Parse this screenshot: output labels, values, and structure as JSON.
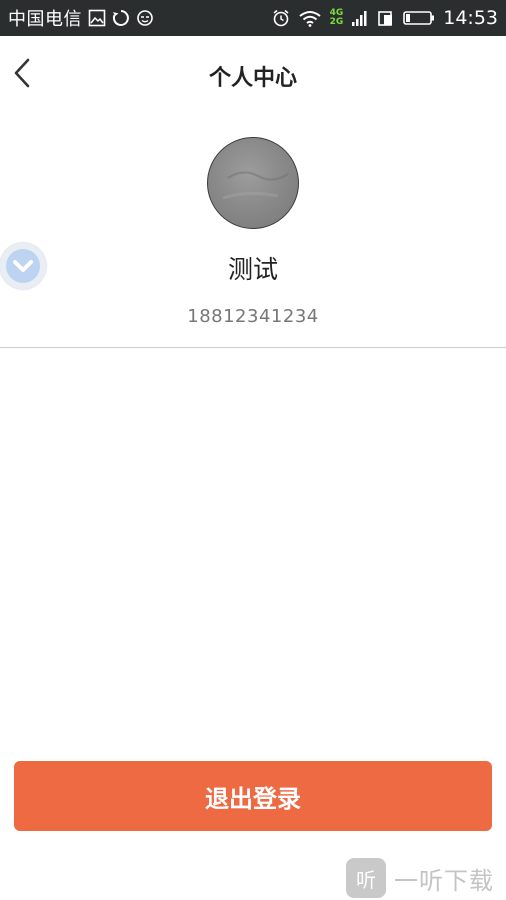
{
  "status_bar": {
    "carrier": "中国电信",
    "network_top": "4G",
    "network_bottom": "2G",
    "time": "14:53"
  },
  "header": {
    "title": "个人中心"
  },
  "profile": {
    "name": "测试",
    "phone": "18812341234"
  },
  "actions": {
    "logout_label": "退出登录"
  },
  "watermark": {
    "logo_text": "听",
    "text": "一听下载"
  },
  "colors": {
    "accent": "#ed6a43",
    "status_bar_bg": "#2b2e2f",
    "text_primary": "#222222",
    "text_secondary": "#777777"
  }
}
